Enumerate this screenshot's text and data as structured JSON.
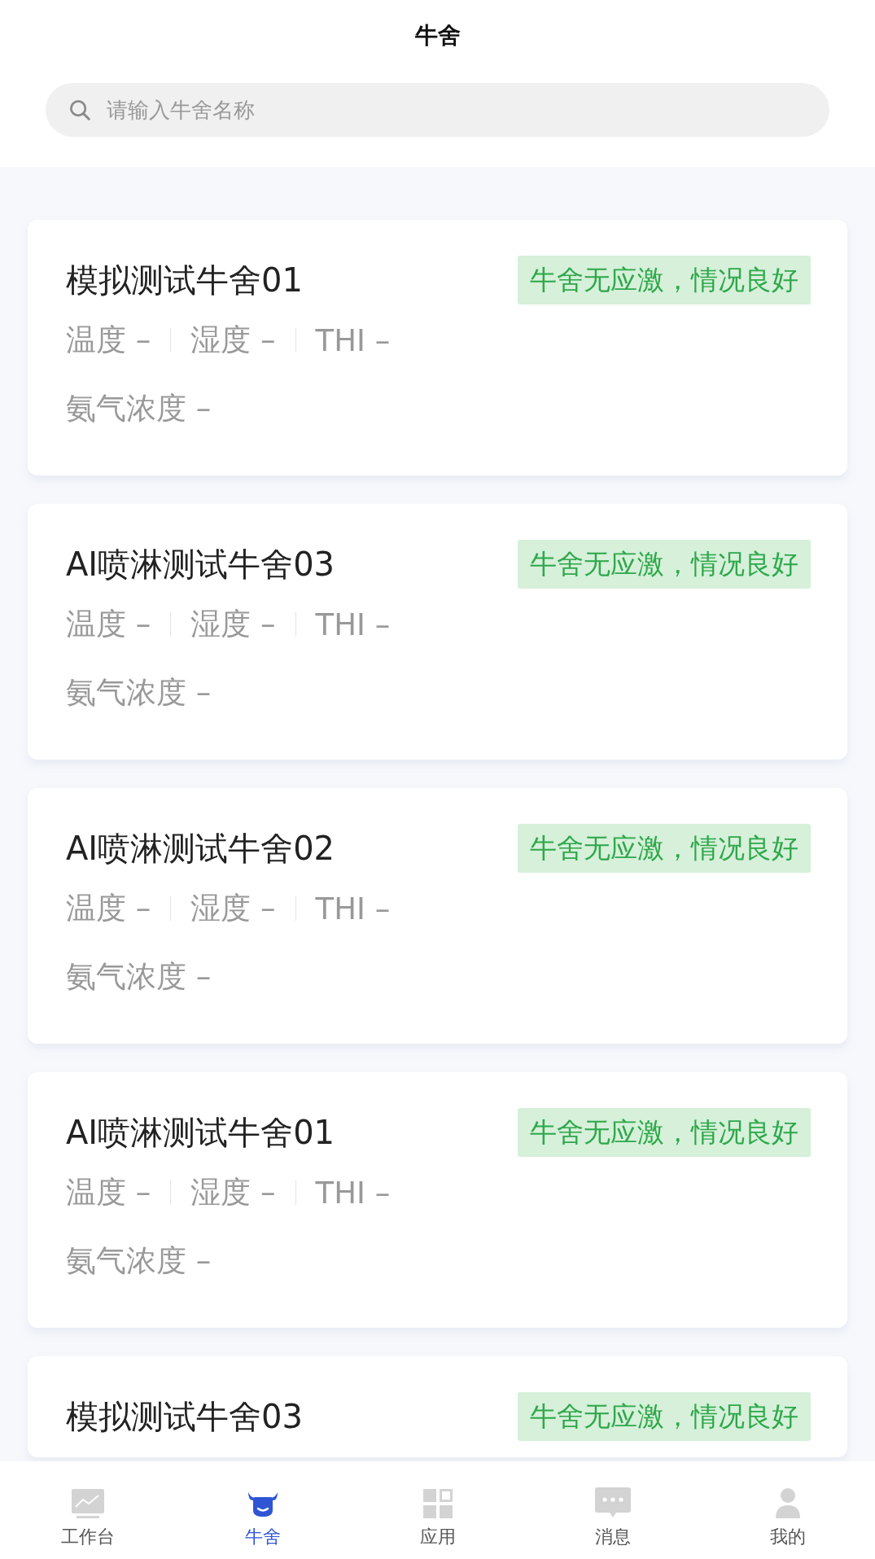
{
  "header": {
    "title": "牛舍"
  },
  "search": {
    "placeholder": "请输入牛舍名称"
  },
  "barns": [
    {
      "name": "模拟测试牛舍01",
      "status": "牛舍无应激，情况良好",
      "metrics": [
        "温度 –",
        "湿度 –",
        "THI –"
      ],
      "ammonia": "氨气浓度 –"
    },
    {
      "name": "AI喷淋测试牛舍03",
      "status": "牛舍无应激，情况良好",
      "metrics": [
        "温度 –",
        "湿度 –",
        "THI –"
      ],
      "ammonia": "氨气浓度 –"
    },
    {
      "name": "AI喷淋测试牛舍02",
      "status": "牛舍无应激，情况良好",
      "metrics": [
        "温度 –",
        "湿度 –",
        "THI –"
      ],
      "ammonia": "氨气浓度 –"
    },
    {
      "name": "AI喷淋测试牛舍01",
      "status": "牛舍无应激，情况良好",
      "metrics": [
        "温度 –",
        "湿度 –",
        "THI –"
      ],
      "ammonia": "氨气浓度 –"
    },
    {
      "name": "模拟测试牛舍03",
      "status": "牛舍无应激，情况良好"
    }
  ],
  "tab_bar": [
    {
      "kind": "chart",
      "label": "工作台",
      "selected": false
    },
    {
      "kind": "cow",
      "label": "牛舍",
      "selected": true
    },
    {
      "kind": "apps",
      "label": "应用",
      "selected": false
    },
    {
      "kind": "message",
      "label": "消息",
      "selected": false
    },
    {
      "kind": "profile",
      "label": "我的",
      "selected": false
    }
  ]
}
